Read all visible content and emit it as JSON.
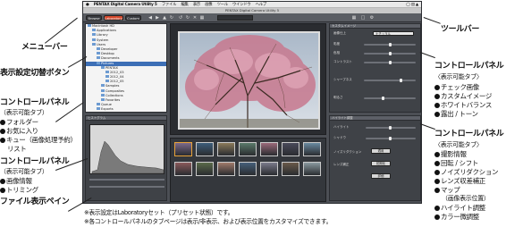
{
  "callouts": {
    "menubar": "メニューバー",
    "view_switch": "表示設定切替ボタン",
    "toolbar": "ツールバー",
    "left_panel_1": {
      "title": "コントロールパネル",
      "subtitle": "（表示可能タブ）",
      "items": [
        "フォルダー",
        "お気に入り",
        "キュー（画像処理予約）"
      ],
      "continuation": "リスト"
    },
    "left_panel_2": {
      "title": "コントロールパネル",
      "subtitle": "（表示可能タブ）",
      "items": [
        "画像情報",
        "トリミング"
      ]
    },
    "file_pane": "ファイル表示ペイン",
    "right_panel_1": {
      "title": "コントロールパネル",
      "subtitle": "〈表示可能タブ〉",
      "items": [
        "チェック画像",
        "カスタムイメージ",
        "ホワイトバランス",
        "露出 / トーン"
      ]
    },
    "right_panel_2": {
      "title": "コントロールパネル",
      "subtitle": "〈表示可能タブ〉",
      "items": [
        "撮影情報",
        "回転 / シフト",
        "ノイズリダクション",
        "レンズ収差補正",
        "マップ",
        "ハイライト調整",
        "カラー微調整"
      ],
      "map_note": "（画像表示位置）"
    },
    "footnotes": [
      "※表示設定はLaboratoryセット（プリセット状態）です。",
      "※各コントロールパネルのタブページは表示/非表示、および表示位置をカスタマイズできます。"
    ]
  },
  "app": {
    "menubar": {
      "apple": "",
      "items": [
        "PENTAX Digital Camera Utility 5",
        "ファイル",
        "編集",
        "表示",
        "画像",
        "ツール",
        "ウインドウ",
        "ヘルプ"
      ]
    },
    "window_title": "PENTAX Digital Camera Utility 5",
    "mode_buttons": [
      "Browse",
      "Laboratory",
      "Custom"
    ],
    "active_mode": "Laboratory",
    "toolbar_icons": [
      "back-icon",
      "forward-icon",
      "up-icon",
      "refresh-icon",
      "rotate-left-icon",
      "rotate-right-icon",
      "delete-icon",
      "compare-icon"
    ],
    "tree_rows": [
      "Macintosh HD",
      "Applications",
      "Library",
      "System",
      "Users",
      "Developer",
      "Desktop",
      "Documents",
      "Pictures",
      "PENTAX",
      "2012_03",
      "2012_04",
      "2012_05",
      "Samples",
      "Composites",
      "Collections",
      "Favorites",
      "Queue",
      "Exports"
    ],
    "tree_selected": "Pictures",
    "histogram_tab": "ヒストグラム",
    "right_panel_top": {
      "tab": "カスタムイメージ",
      "rows": [
        "画像仕上",
        "彩度",
        "色相",
        "コントラスト",
        "シャープネス",
        "明るさ"
      ],
      "dropdown_value": "ナチュラル"
    },
    "right_panel_bottom": {
      "tab": "ハイライト調整",
      "rows": [
        "ハイライト",
        "シャドウ",
        "ノイズリダクション",
        "レンズ補正"
      ],
      "buttons": [
        "適用",
        "初期化",
        "詳細"
      ]
    }
  }
}
